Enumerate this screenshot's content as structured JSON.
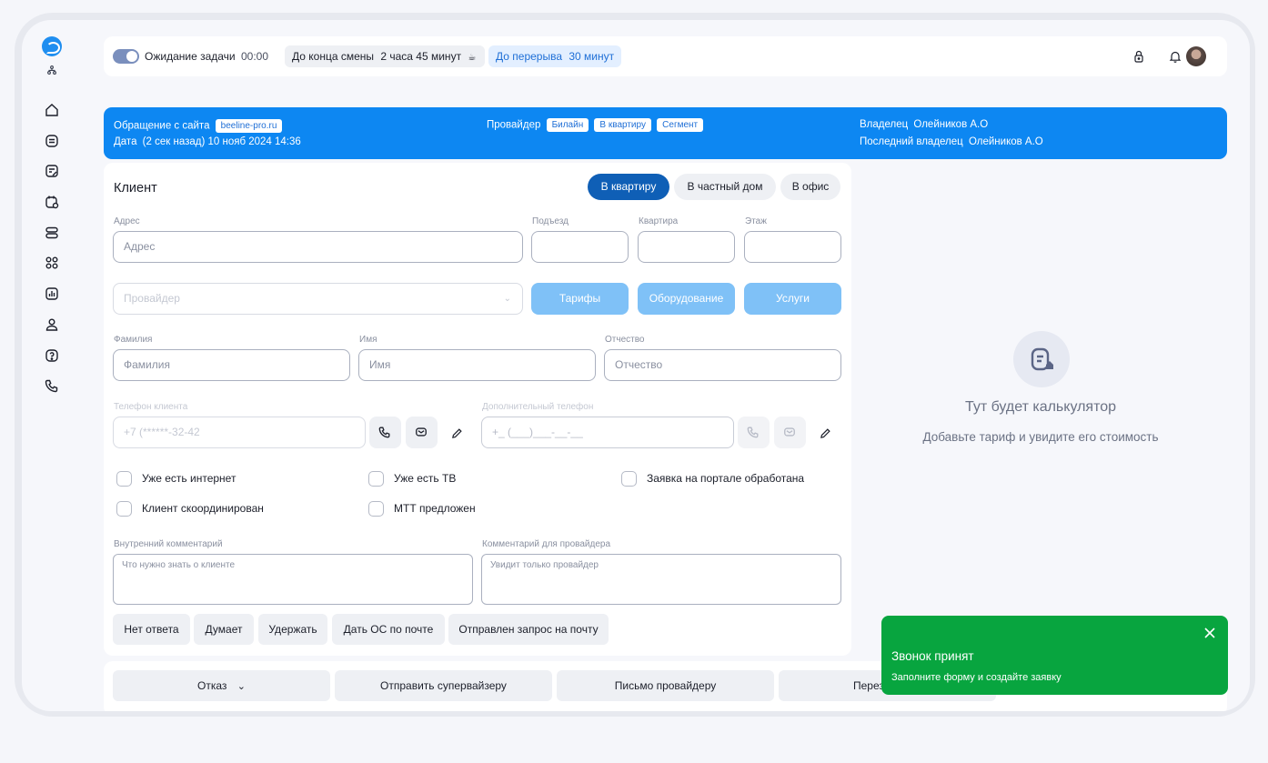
{
  "topbar": {
    "waiting_label": "Ожидание задачи",
    "waiting_timer": "00:00",
    "shift_label": "До конца смены",
    "shift_value": "2 часа 45 минут",
    "break_label": "До перерыва",
    "break_value": "30 минут"
  },
  "request": {
    "source_label": "Обращение с сайта",
    "source_value": "beeline-pro.ru",
    "date_label": "Дата",
    "date_value": "(2 сек назад) 10 нояб 2024 14:36",
    "provider_label": "Провайдер",
    "provider_tags": [
      "Билайн",
      "В квартиру",
      "Сегмент"
    ],
    "owner_label": "Владелец",
    "owner_value": "Олейников А.О",
    "last_owner_label": "Последний владелец",
    "last_owner_value": "Олейников А.О"
  },
  "client": {
    "title": "Клиент",
    "segments": [
      "В квартиру",
      "В частный дом",
      "В офис"
    ],
    "address_label": "Адрес",
    "address_placeholder": "Адрес",
    "entrance_label": "Подъезд",
    "apartment_label": "Квартира",
    "floor_label": "Этаж",
    "provider_placeholder": "Провайдер",
    "tariffs_button": "Тарифы",
    "equipment_button": "Оборудование",
    "services_button": "Услуги",
    "lastname_label": "Фамилия",
    "lastname_placeholder": "Фамилия",
    "firstname_label": "Имя",
    "firstname_placeholder": "Имя",
    "middlename_label": "Отчество",
    "middlename_placeholder": "Отчество",
    "phone_label": "Телефон клиента",
    "phone_value": "+7 (******-32-42",
    "extra_phone_label": "Дополнительный телефон",
    "extra_phone_placeholder": "+_ (___)___-__-__",
    "checkboxes": [
      "Уже есть интернет",
      "Уже есть ТВ",
      "Заявка на портале обработана",
      "Клиент скоординирован",
      "МТТ предложен"
    ],
    "internal_comment_label": "Внутренний комментарий",
    "internal_comment_placeholder": "Что нужно знать о клиенте",
    "provider_comment_label": "Комментарий для провайдера",
    "provider_comment_placeholder": "Увидит только провайдер",
    "quick_buttons": [
      "Нет ответа",
      "Думает",
      "Удержать",
      "Дать ОС по почте",
      "Отправлен запрос на почту"
    ]
  },
  "actions": {
    "reject": "Отказ",
    "supervisor": "Отправить супервайзеру",
    "provider_letter": "Письмо провайдеру",
    "partial": "Перез"
  },
  "calculator": {
    "title": "Тут будет калькулятор",
    "subtitle": "Добавьте тариф и увидите его стоимость"
  },
  "toast": {
    "title": "Звонок принят",
    "text": "Заполните форму и создайте заявку"
  },
  "colors": {
    "primary": "#0d87f2",
    "dark_blue": "#0f5fb6",
    "light_blue": "#7fc1f7",
    "success": "#08a53f"
  }
}
